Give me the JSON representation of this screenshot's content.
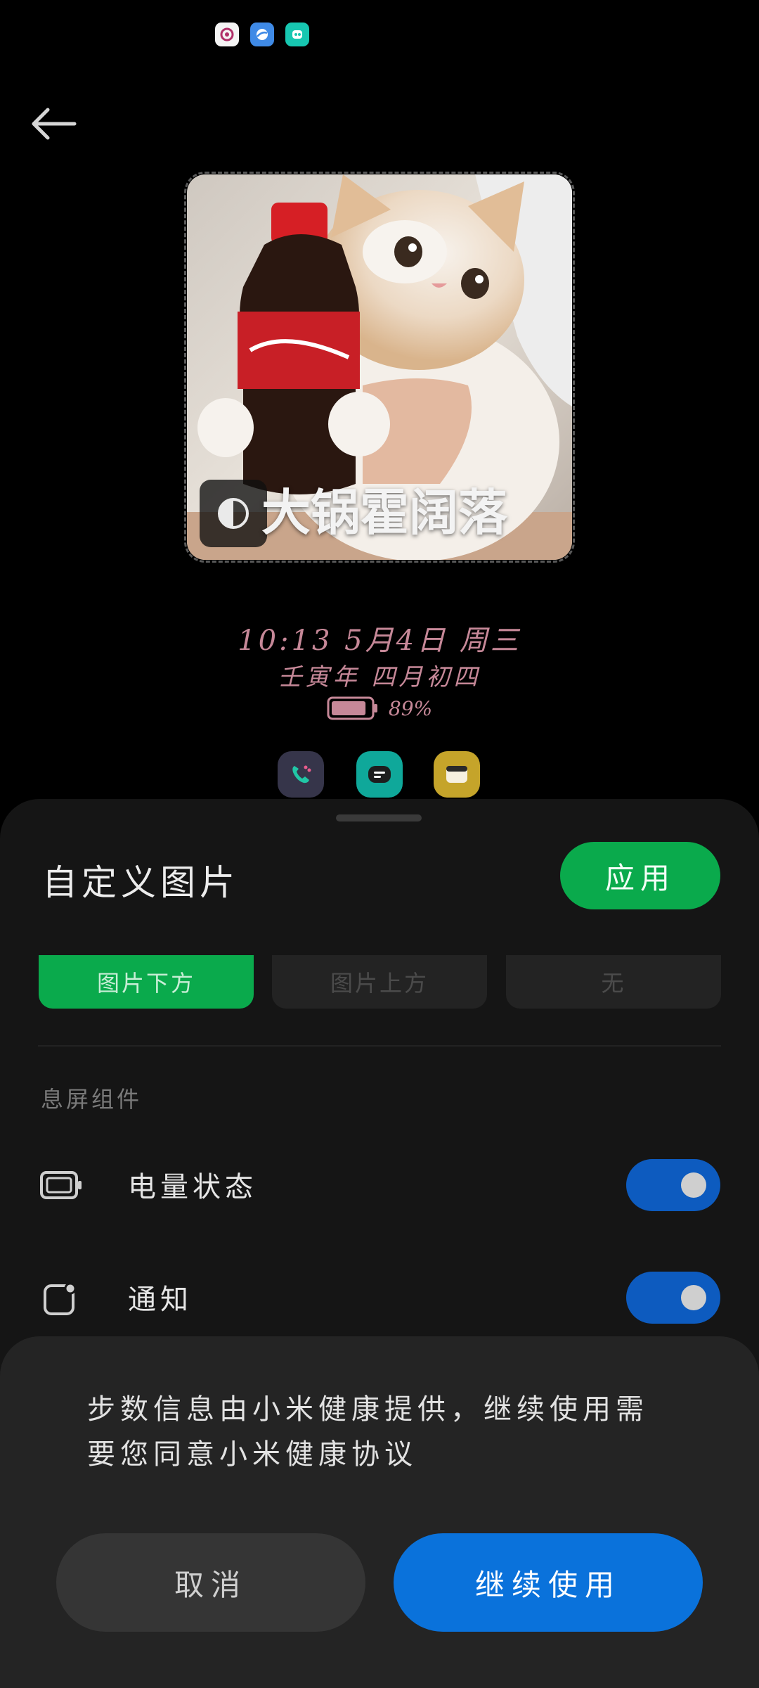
{
  "preview": {
    "watermark_text": "大锅霍阔落"
  },
  "aod": {
    "time_date_line": "10:13 5月4日 周三",
    "lunar_line": "壬寅年 四月初四",
    "battery_percent": "89%",
    "battery_level": 0.89
  },
  "sheet": {
    "title": "自定义图片",
    "apply_label": "应用",
    "position_options": [
      "图片下方",
      "图片上方",
      "无"
    ],
    "selected_position": "图片下方",
    "section_label": "息屏组件",
    "rows": [
      {
        "label": "电量状态",
        "enabled": true
      },
      {
        "label": "通知",
        "enabled": true
      }
    ]
  },
  "dialog": {
    "message": "步数信息由小米健康提供，继续使用需要您同意小米健康协议",
    "cancel_label": "取消",
    "continue_label": "继续使用"
  },
  "colors": {
    "accent_green": "#0aaa4c",
    "accent_blue": "#0a72db",
    "toggle_blue": "#0d5bbf",
    "aod_text": "#c68898"
  }
}
